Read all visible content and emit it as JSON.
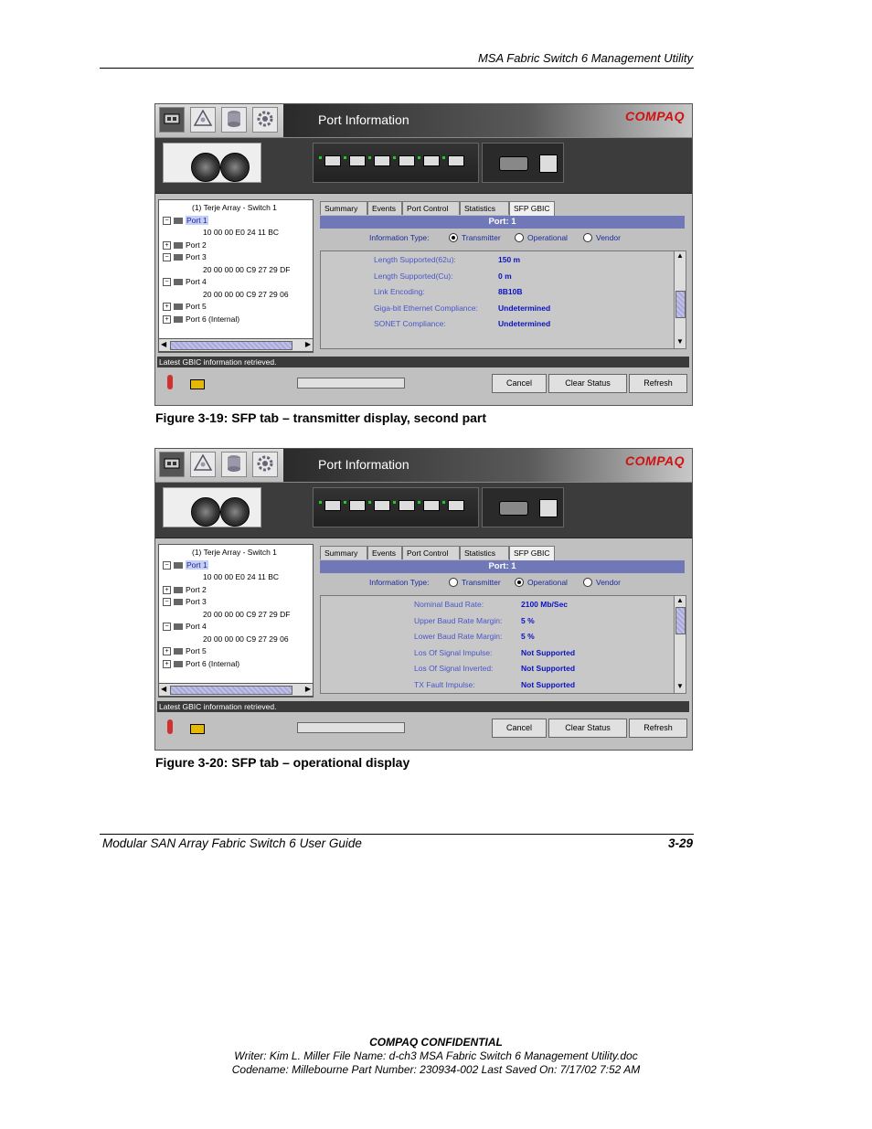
{
  "page": {
    "header": "MSA Fabric Switch 6 Management Utility",
    "footer_left": "Modular SAN Array Fabric Switch 6 User Guide",
    "footer_right": "3-29",
    "confidential": "COMPAQ CONFIDENTIAL",
    "writer_line": "Writer: Kim L. Miller File Name: d-ch3 MSA Fabric Switch 6 Management Utility.doc",
    "codename_line": "Codename: Millebourne Part Number: 230934-002 Last Saved On: 7/17/02 7:52 AM"
  },
  "figures": [
    {
      "caption": "Figure 3-19:  SFP tab – transmitter display, second part",
      "window_title": "Port Information",
      "brand": "COMPAQ",
      "tree": [
        {
          "label": "(1) Terje Array - Switch 1",
          "kind": "root"
        },
        {
          "label": "Port 1",
          "kind": "port",
          "expanded": true,
          "selected": true
        },
        {
          "label": "10 00 00 E0 24 11 BC",
          "kind": "wwn"
        },
        {
          "label": "Port 2",
          "kind": "port",
          "expanded": false
        },
        {
          "label": "Port 3",
          "kind": "port",
          "expanded": true
        },
        {
          "label": "20 00 00 00 C9 27 29 DF",
          "kind": "wwn"
        },
        {
          "label": "Port 4",
          "kind": "port",
          "expanded": true
        },
        {
          "label": "20 00 00 00 C9 27 29 06",
          "kind": "wwn"
        },
        {
          "label": "Port 5",
          "kind": "port",
          "expanded": false
        },
        {
          "label": "Port 6 (Internal)",
          "kind": "port",
          "expanded": false
        }
      ],
      "tabs": [
        "Summary",
        "Events",
        "Port Control",
        "Statistics",
        "SFP GBIC"
      ],
      "active_tab": "SFP GBIC",
      "port_label": "Port: 1",
      "info_type_label": "Information Type:",
      "radios": [
        "Transmitter",
        "Operational",
        "Vendor"
      ],
      "selected_radio": "Transmitter",
      "details": [
        {
          "k": "Length Supported(62u):",
          "v": "150 m"
        },
        {
          "k": "Length Supported(Cu):",
          "v": "0 m"
        },
        {
          "k": "Link Encoding:",
          "v": "8B10B"
        },
        {
          "k": "Giga-bit Ethernet Compliance:",
          "v": "Undetermined"
        },
        {
          "k": "SONET Compliance:",
          "v": "Undetermined"
        }
      ],
      "scroll_position": 0.6,
      "status_text": "Latest GBIC information retrieved.",
      "buttons": [
        "Cancel",
        "Clear Status",
        "Refresh"
      ]
    },
    {
      "caption": "Figure 3-20:  SFP tab – operational display",
      "window_title": "Port Information",
      "brand": "COMPAQ",
      "tree": [
        {
          "label": "(1) Terje Array - Switch 1",
          "kind": "root"
        },
        {
          "label": "Port 1",
          "kind": "port",
          "expanded": true,
          "selected": true
        },
        {
          "label": "10 00 00 E0 24 11 BC",
          "kind": "wwn"
        },
        {
          "label": "Port 2",
          "kind": "port",
          "expanded": false
        },
        {
          "label": "Port 3",
          "kind": "port",
          "expanded": true
        },
        {
          "label": "20 00 00 00 C9 27 29 DF",
          "kind": "wwn"
        },
        {
          "label": "Port 4",
          "kind": "port",
          "expanded": true
        },
        {
          "label": "20 00 00 00 C9 27 29 06",
          "kind": "wwn"
        },
        {
          "label": "Port 5",
          "kind": "port",
          "expanded": false
        },
        {
          "label": "Port 6 (Internal)",
          "kind": "port",
          "expanded": false
        }
      ],
      "tabs": [
        "Summary",
        "Events",
        "Port Control",
        "Statistics",
        "SFP GBIC"
      ],
      "active_tab": "SFP GBIC",
      "port_label": "Port: 1",
      "info_type_label": "Information Type:",
      "radios": [
        "Transmitter",
        "Operational",
        "Vendor"
      ],
      "selected_radio": "Operational",
      "details": [
        {
          "k": "Nominal Baud Rate:",
          "v": "2100 Mb/Sec"
        },
        {
          "k": "Upper Baud Rate Margin:",
          "v": "5 %"
        },
        {
          "k": "Lower Baud Rate Margin:",
          "v": "5 %"
        },
        {
          "k": "Los Of Signal Impulse:",
          "v": "Not Supported"
        },
        {
          "k": "Los Of Signal Inverted:",
          "v": "Not Supported"
        },
        {
          "k": "TX Fault Impulse:",
          "v": "Not Supported"
        }
      ],
      "scroll_position": 0.0,
      "status_text": "Latest GBIC information retrieved.",
      "buttons": [
        "Cancel",
        "Clear Status",
        "Refresh"
      ]
    }
  ]
}
